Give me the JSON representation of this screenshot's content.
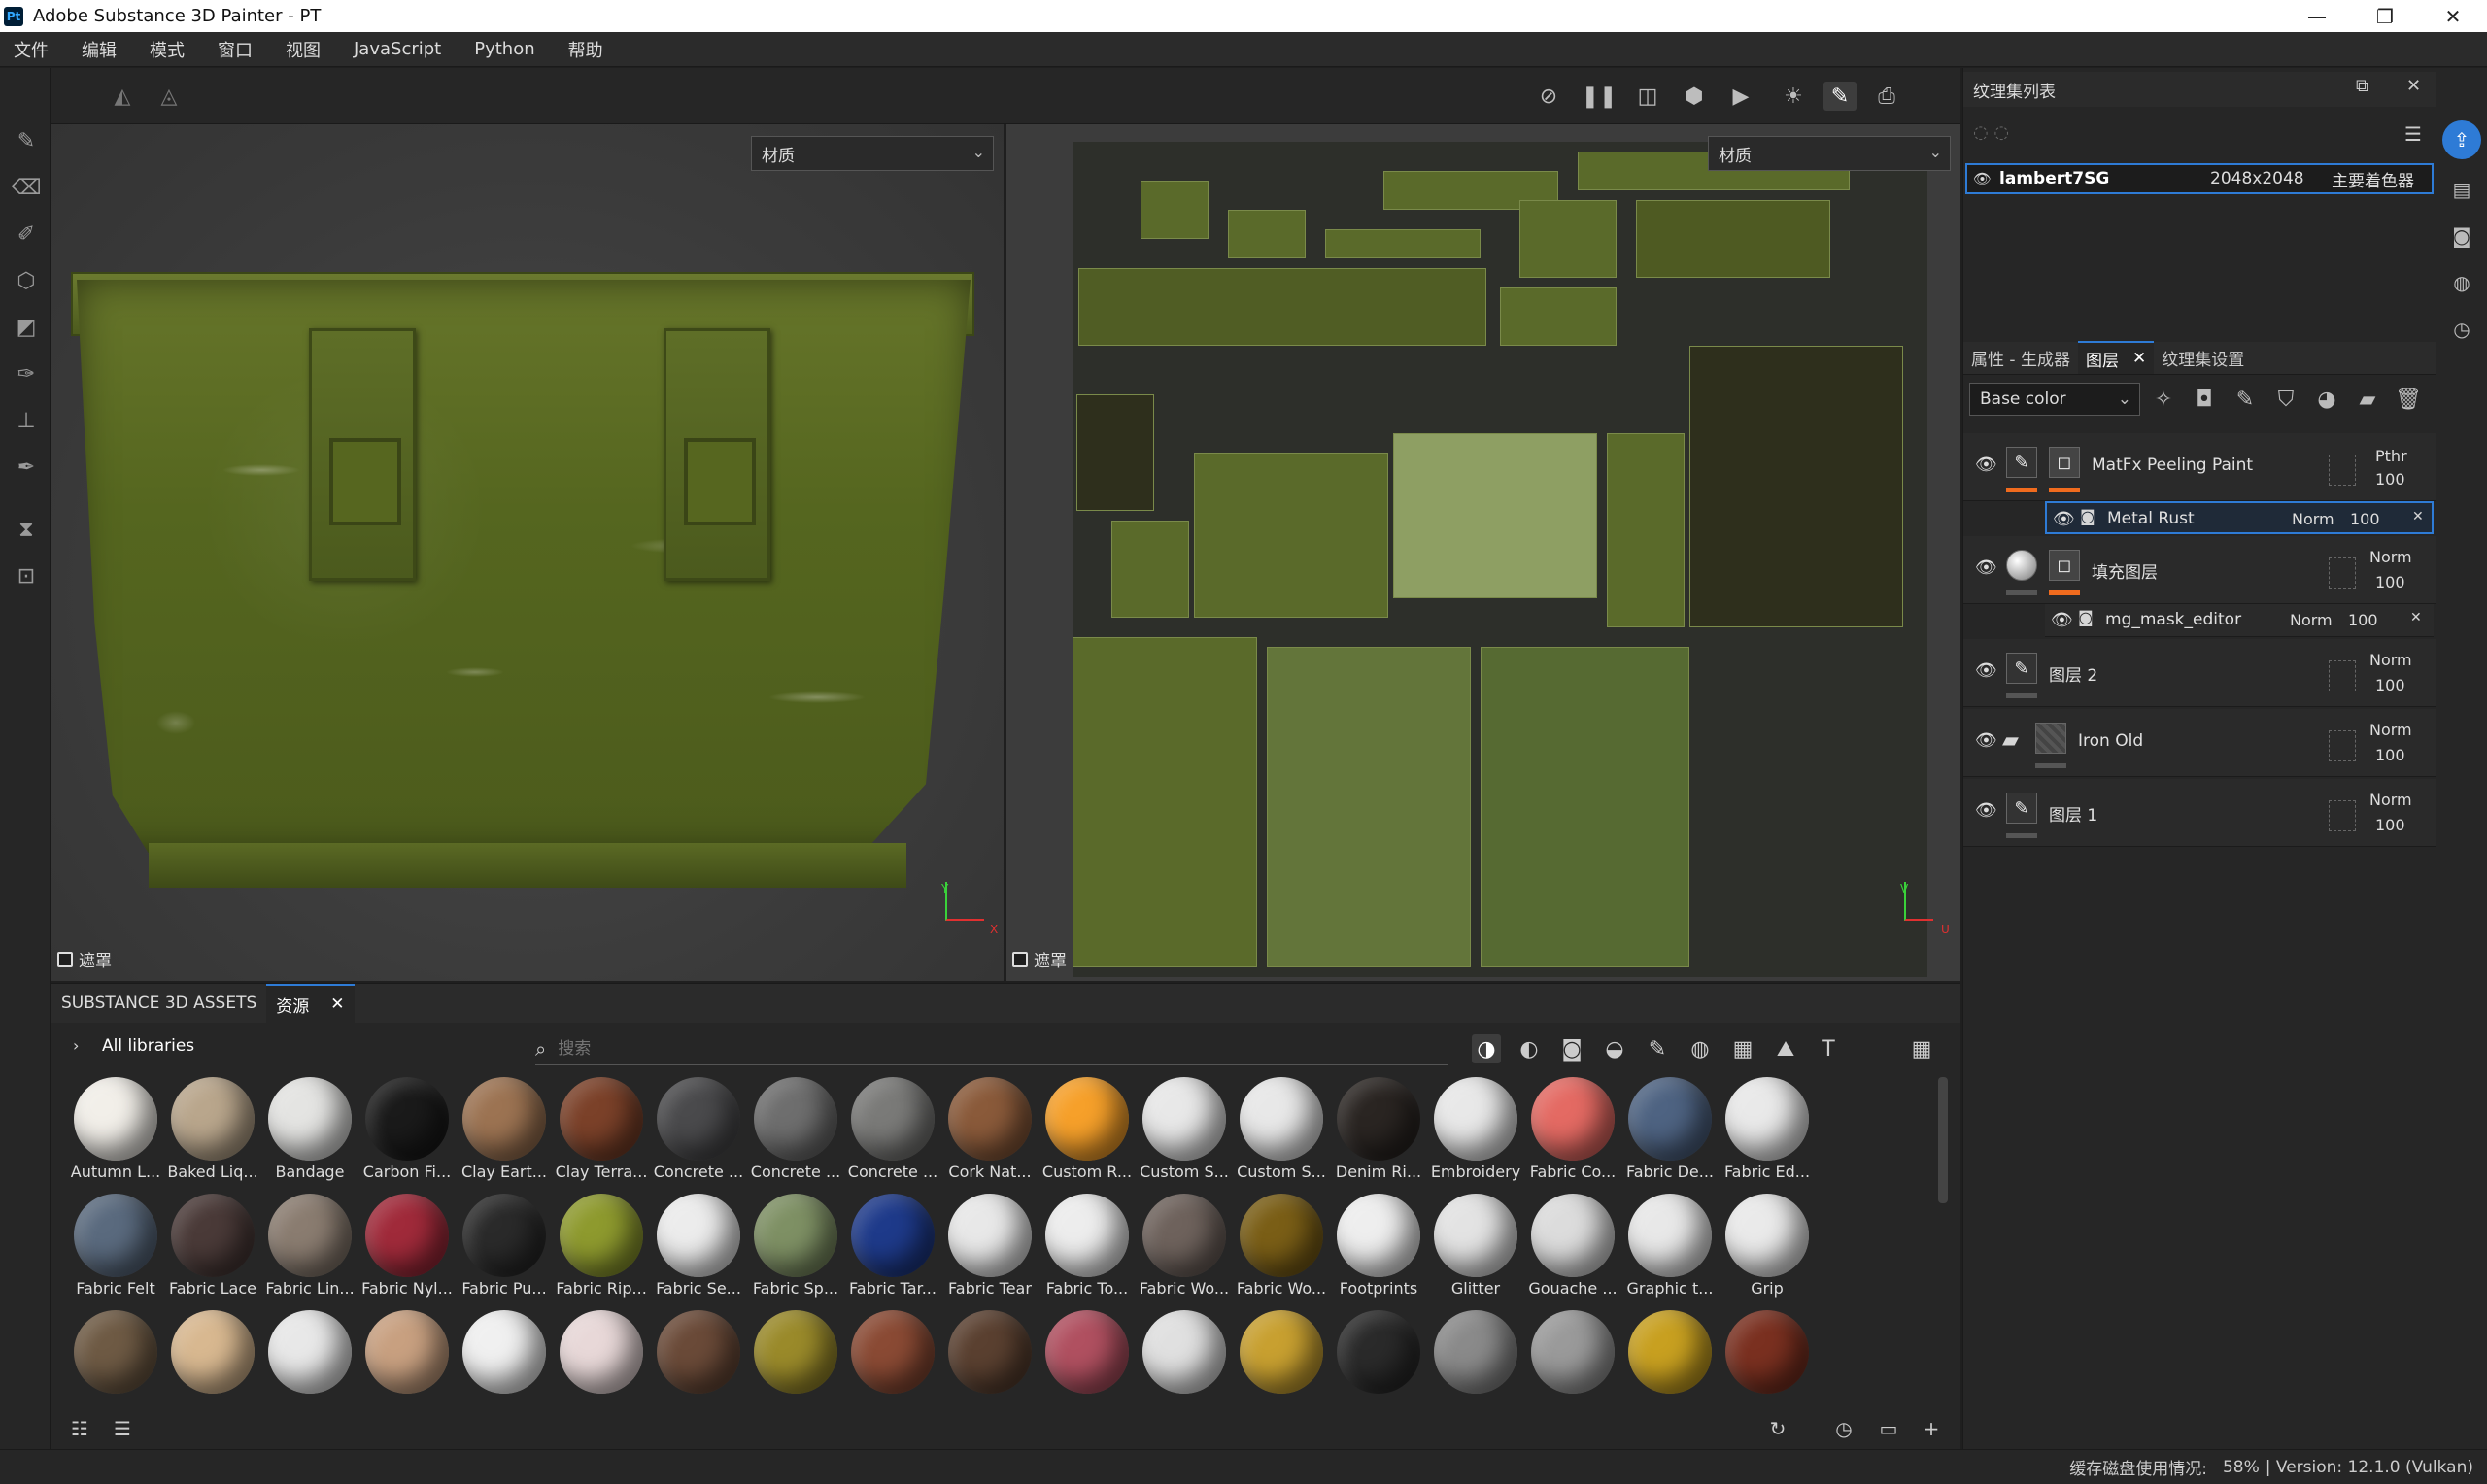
{
  "window": {
    "app_icon": "Pt",
    "title": "Adobe Substance 3D Painter - PT",
    "minimize": "—",
    "maximize": "❐",
    "close": "✕"
  },
  "menu": [
    "文件",
    "编辑",
    "模式",
    "窗口",
    "视图",
    "JavaScript",
    "Python",
    "帮助"
  ],
  "viewport": {
    "left_dropdown": "材质",
    "right_dropdown": "材质",
    "left_mask": "遮罩",
    "right_mask": "遮罩",
    "axis_3d": [
      "Y",
      "X"
    ],
    "axis_2d": [
      "V",
      "U"
    ]
  },
  "texture_set_list": {
    "title": "纹理集列表",
    "row": {
      "name": "lambert7SG",
      "resolution": "2048x2048",
      "shader": "主要着色器"
    }
  },
  "tabs": {
    "properties": "属性 - 生成器",
    "layers": "图层",
    "texset_settings": "纹理集设置"
  },
  "layers_toolbar": {
    "channel": "Base color"
  },
  "layers": [
    {
      "name": "MatFx Peeling Paint",
      "blend": "Pthr",
      "opacity": "100"
    },
    {
      "name": "Metal Rust",
      "blend": "Norm",
      "opacity": "100"
    },
    {
      "name": "填充图层",
      "blend": "Norm",
      "opacity": "100"
    },
    {
      "name": "mg_mask_editor",
      "blend": "Norm",
      "opacity": "100"
    },
    {
      "name": "图层 2",
      "blend": "Norm",
      "opacity": "100"
    },
    {
      "name": "Iron Old",
      "blend": "Norm",
      "opacity": "100"
    },
    {
      "name": "图层 1",
      "blend": "Norm",
      "opacity": "100"
    }
  ],
  "assets": {
    "tab_assets": "SUBSTANCE 3D ASSETS",
    "tab_resources": "资源",
    "libraries": "All libraries",
    "search_placeholder": "搜索",
    "items_row1": [
      {
        "label": "Autumn L...",
        "color": "#f2efe9"
      },
      {
        "label": "Baked Liq...",
        "color": "#b9a68c"
      },
      {
        "label": "Bandage",
        "color": "#e4e4e2"
      },
      {
        "label": "Carbon Fi...",
        "color": "#1a1a1a"
      },
      {
        "label": "Clay Eart...",
        "color": "#9c7352"
      },
      {
        "label": "Clay Terra...",
        "color": "#7b4129"
      },
      {
        "label": "Concrete ...",
        "color": "#4a4a4c"
      },
      {
        "label": "Concrete ...",
        "color": "#6e6e6e"
      },
      {
        "label": "Concrete ...",
        "color": "#7a7a78"
      },
      {
        "label": "Cork Nat...",
        "color": "#8a5a3a"
      },
      {
        "label": "Custom R...",
        "color": "#f6a02a"
      },
      {
        "label": "Custom S...",
        "color": "#e8e8e8"
      },
      {
        "label": "Custom S...",
        "color": "#e8e8e8"
      },
      {
        "label": "Denim Ri...",
        "color": "#2a2522"
      },
      {
        "label": "Embroidery",
        "color": "#e8e8e8"
      },
      {
        "label": "Fabric Co...",
        "color": "#e46a63"
      },
      {
        "label": "Fabric De...",
        "color": "#4e6382"
      },
      {
        "label": "Fabric Ed...",
        "color": "#e9e9e9"
      }
    ],
    "items_row2": [
      {
        "label": "Fabric Felt",
        "color": "#5a6a7e"
      },
      {
        "label": "Fabric Lace",
        "color": "#4a3a38"
      },
      {
        "label": "Fabric Lin...",
        "color": "#8a7c70"
      },
      {
        "label": "Fabric Nyl...",
        "color": "#a02a3a"
      },
      {
        "label": "Fabric Pu...",
        "color": "#2a2a2a"
      },
      {
        "label": "Fabric Rip...",
        "color": "#8e9a2e"
      },
      {
        "label": "Fabric Se...",
        "color": "#ececec"
      },
      {
        "label": "Fabric Sp...",
        "color": "#7e9064"
      },
      {
        "label": "Fabric Tar...",
        "color": "#1e3a8a"
      },
      {
        "label": "Fabric Tear",
        "color": "#e8e8e8"
      },
      {
        "label": "Fabric To...",
        "color": "#ededed"
      },
      {
        "label": "Fabric Wo...",
        "color": "#6e625c"
      },
      {
        "label": "Fabric Wo...",
        "color": "#7a5e16"
      },
      {
        "label": "Footprints",
        "color": "#eeeeee"
      },
      {
        "label": "Glitter",
        "color": "#e3e3e3"
      },
      {
        "label": "Gouache ...",
        "color": "#dcdcdc"
      },
      {
        "label": "Graphic t...",
        "color": "#e8e8e8"
      },
      {
        "label": "Grip",
        "color": "#eaeaea"
      }
    ],
    "items_row3": [
      {
        "label": "",
        "color": "#6e5a44"
      },
      {
        "label": "",
        "color": "#d8b890"
      },
      {
        "label": "",
        "color": "#e8e8e8"
      },
      {
        "label": "",
        "color": "#c8a080"
      },
      {
        "label": "",
        "color": "#f0f0f0"
      },
      {
        "label": "",
        "color": "#e8d8d8"
      },
      {
        "label": "",
        "color": "#6a4a38"
      },
      {
        "label": "",
        "color": "#9a8a2a"
      },
      {
        "label": "",
        "color": "#8a4a34"
      },
      {
        "label": "",
        "color": "#5a4030"
      },
      {
        "label": "",
        "color": "#b05060"
      },
      {
        "label": "",
        "color": "#e0e0e0"
      },
      {
        "label": "",
        "color": "#c8a030"
      },
      {
        "label": "",
        "color": "#2a2a2a"
      },
      {
        "label": "",
        "color": "#8a8a8a"
      },
      {
        "label": "",
        "color": "#9a9a9a"
      },
      {
        "label": "",
        "color": "#c8a020"
      },
      {
        "label": "",
        "color": "#7a3020"
      }
    ]
  },
  "status": {
    "cache_label": "缓存磁盘使用情况:",
    "cache_value": "58%",
    "version": "| Version: 12.1.0 (Vulkan)"
  }
}
